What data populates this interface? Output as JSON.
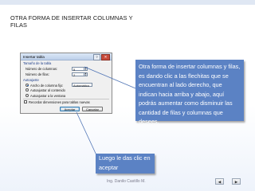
{
  "slide": {
    "title": "OTRA FORMA DE INSERTAR COLUMNAS Y FILAS",
    "callout_main": "Otra forma de insertar columnas y filas,  es dando clic a las flechitas que se encuentran al lado derecho, que indican hacia arriba y abajo, aquí podrás aumentar como disminuir las cantidad de filas y columnas que desees.",
    "callout_bottom": "Luego le das clic en aceptar",
    "footer": "Ing. Danilo Castillo M.",
    "colors": {
      "callout_bg": "#5b82c4",
      "text": "#1a1a1a"
    }
  },
  "dialog": {
    "title": "Insertar tabla",
    "help_glyph": "?",
    "close_glyph": "✕",
    "group_size": "Tamaño de la tabla",
    "columns_label": "Número de columnas:",
    "columns_value": "5",
    "rows_label": "Número de filas:",
    "rows_value": "2",
    "group_autofit": "Autoajuste",
    "fixed_width_label": "Ancho de columna fijo:",
    "fixed_width_value": "Automático",
    "autofit_content_label": "Autoajustar al contenido",
    "autofit_window_label": "Autoajustar a la ventana",
    "remember_label": "Recordar dimensiones para tablas nuevas",
    "ok_label": "Aceptar",
    "cancel_label": "Cancelar"
  },
  "nav": {
    "prev_icon": "prev-slide-icon",
    "next_icon": "next-slide-icon",
    "prev_glyph": "◀",
    "next_glyph": "▶"
  }
}
